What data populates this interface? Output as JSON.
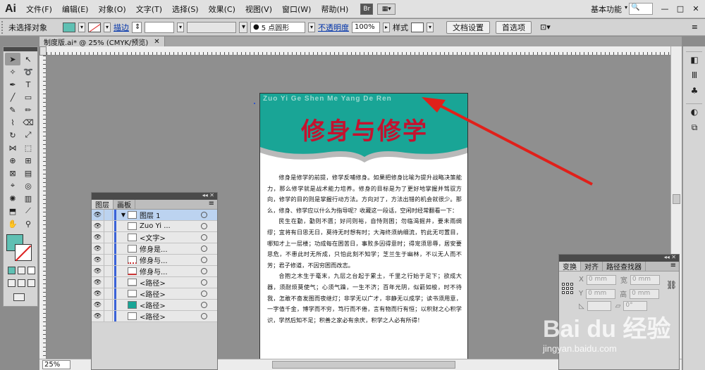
{
  "app": {
    "logo": "Ai",
    "workspace": "基本功能"
  },
  "menu": [
    "文件(F)",
    "编辑(E)",
    "对象(O)",
    "文字(T)",
    "选择(S)",
    "效果(C)",
    "视图(V)",
    "窗口(W)",
    "帮助(H)"
  ],
  "menubar_buttons": {
    "bridge": "Br"
  },
  "window_controls": {
    "minimize": "—",
    "restore": "□",
    "close": "✕"
  },
  "control_bar": {
    "selection": "未选择对象",
    "stroke_label": "描边",
    "brush": "5 点圆形",
    "opacity_label": "不透明度",
    "opacity_value": "100%",
    "style_label": "样式",
    "doc_setup": "文档设置",
    "prefs": "首选项",
    "fill_color": "#5fc0b3"
  },
  "document": {
    "tab_title": "制度版.ai* @ 25% (CMYK/预览)",
    "close": "✕"
  },
  "zoom": "25%",
  "artboard": {
    "subtitle": "Zuo Yi Ge Shen Me Yang De Ren",
    "title": "修身与修学",
    "banner_color": "#19a596",
    "title_color": "#c4122f",
    "paragraphs": [
      "修身是修学的前提，修学反哺修身。如果把修身比喻为提升战略决策能力，那么修学就是战术能力培养。修身的目标是为了更好地掌握并驾驭方向，修学的目的则是掌握行动方法。方向对了，方法出错的机会就很少。那么，修身、修学应以什么为指导呢？收藏这一段话，空闲时经常翻看一下：",
      "民生在勤，勤则不匮；好问则裕，自恃则困；勿临渴掘井，要未雨绸缪；宜将有日思无日，莫待无时想有时；大海终须纳细流，钓此无可置目，哪知才上一层楼；功成每在困苦日，事败多因得意时；得宠须思辱，居安要思危，不患此时无所成，只怕此刻不知学；芝兰生于幽林，不以无人而不芳；君子修道，不因穷困而改志。",
      "合抱之木生于毫末，九层之台起于累土，千里之行始于足下；欲成大器，须耐烦莫使气；心须气躁，一生不济；百年光阴，似箭如梭，时不待我，怎敢不奋发图而夜继灯；非学无以广才，非静无以成学；读书须用意，一字值千金，博学而不穷，笃行而不倦，言有物而行有恒；以积财之心积学识，学然后知不足；积善之家必有余庆，积学之人必有所得！"
    ]
  },
  "layers_panel": {
    "tabs": [
      "图层",
      "画板"
    ],
    "rows": [
      {
        "name": "图层 1",
        "top": true
      },
      {
        "name": "Zuo Yi ..."
      },
      {
        "name": "<文字>"
      },
      {
        "name": "修身是..."
      },
      {
        "name": "修身与..."
      },
      {
        "name": "修身与..."
      },
      {
        "name": "<路径>"
      },
      {
        "name": "<路径>"
      },
      {
        "name": "<路径>"
      },
      {
        "name": "<路径>"
      }
    ]
  },
  "transform_panel": {
    "tabs": [
      "变换",
      "对齐",
      "路径查找器"
    ],
    "x_label": "X",
    "y_label": "Y",
    "w_label": "宽",
    "h_label": "高",
    "x": "0 mm",
    "y": "0 mm",
    "w": "0 mm",
    "h": "0 mm",
    "angle": "0°"
  },
  "watermark": {
    "brand": "Bai du 经验",
    "url": "jingyan.baidu.com"
  },
  "arrow_color": "#e0201a"
}
